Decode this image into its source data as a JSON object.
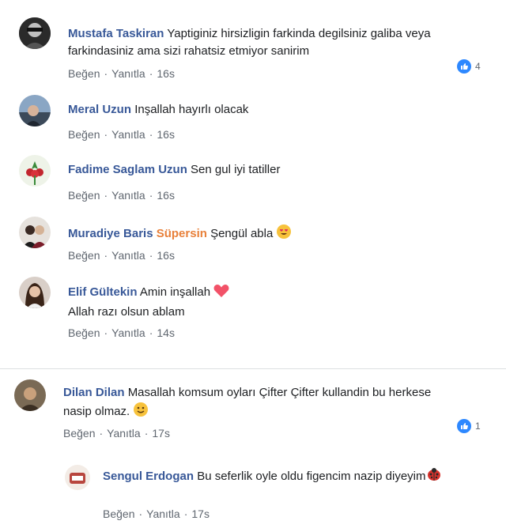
{
  "comments": [
    {
      "name": "Mustafa Taskiran",
      "text_line1": "Yaptiginiz hirsizligin farkinda degilsiniz galiba veya",
      "text_line2": "farkindasiniz ama sizi rahatsiz etmiyor sanirim",
      "like": "Beğen",
      "reply": "Yanıtla",
      "time": "16s",
      "reaction_count": "4"
    },
    {
      "name": "Meral Uzun",
      "text_line1": "Inşallah hayırlı olacak",
      "like": "Beğen",
      "reply": "Yanıtla",
      "time": "16s"
    },
    {
      "name": "Fadime Saglam Uzun",
      "text_line1": "Sen gul iyi tatiller",
      "like": "Beğen",
      "reply": "Yanıtla",
      "time": "16s"
    },
    {
      "name": "Muradiye Baris",
      "tag": "Süpersin",
      "text_line1": "Şengül abla",
      "like": "Beğen",
      "reply": "Yanıtla",
      "time": "16s"
    },
    {
      "name": "Elif Gültekin",
      "text_line1": "Amin inşallah",
      "text_line2": "Allah razı olsun ablam",
      "like": "Beğen",
      "reply": "Yanıtla",
      "time": "14s"
    },
    {
      "name": "Dilan Dilan",
      "text_line1": "Masallah komsum oyları Çifter Çifter kullandin bu herkese",
      "text_line2": "nasip olmaz.",
      "like": "Beğen",
      "reply": "Yanıtla",
      "time": "17s",
      "reaction_count": "1"
    },
    {
      "name": "Sengul Erdogan",
      "text_line1": "Bu seferlik oyle oldu figencim nazip diyeyim",
      "like": "Beğen",
      "reply": "Yanıtla",
      "time": "17s"
    }
  ],
  "colors": {
    "name": "#385898",
    "tag": "#e8803a",
    "reaction": "#2d88ff",
    "meta": "#606770"
  },
  "icons": [
    "like-icon",
    "heart-emoji-icon",
    "heart-eyes-emoji-icon",
    "smile-emoji-icon",
    "ladybug-emoji-icon"
  ]
}
